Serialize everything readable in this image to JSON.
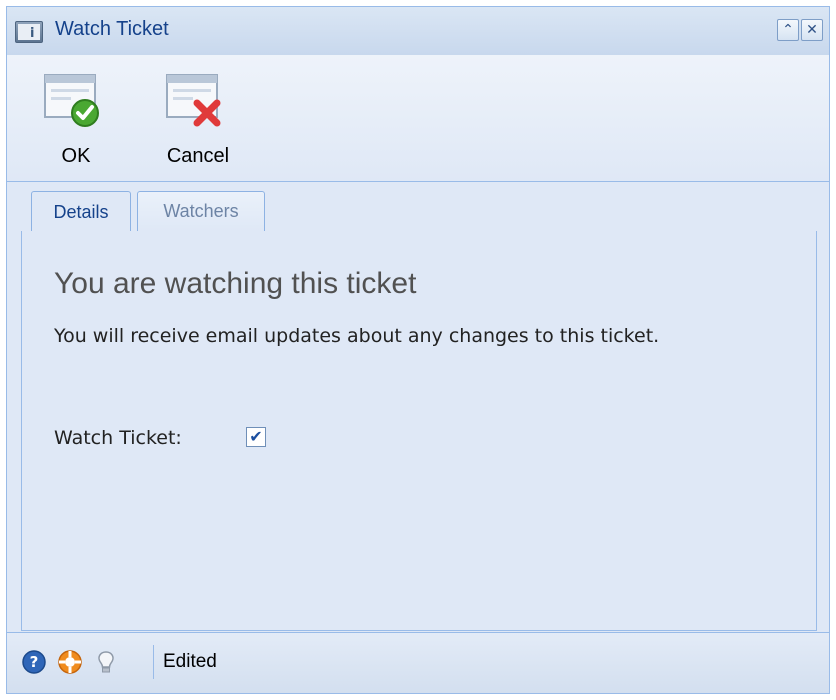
{
  "window": {
    "title": "Watch Ticket",
    "icons": {
      "title": "info-window-icon",
      "collapse": "double-chevron-up-icon",
      "close": "close-icon"
    }
  },
  "toolbar": {
    "ok_label": "OK",
    "cancel_label": "Cancel",
    "icons": {
      "ok": "window-check-icon",
      "cancel": "window-cross-icon"
    }
  },
  "tabs": [
    {
      "label": "Details",
      "active": true
    },
    {
      "label": "Watchers",
      "active": false
    }
  ],
  "details": {
    "heading": "You are watching this ticket",
    "description": "You will receive email updates about any changes to this ticket.",
    "watch_label": "Watch Ticket:",
    "watch_checked": true
  },
  "statusbar": {
    "text": "Edited",
    "icons": [
      "help-icon",
      "support-lifebuoy-icon",
      "lightbulb-icon"
    ]
  },
  "colors": {
    "panel_bg": "#dfe8f6",
    "border": "#99bbe8",
    "title_text": "#15428b",
    "ok_green": "#4aa832",
    "cancel_red": "#e03a3a"
  }
}
